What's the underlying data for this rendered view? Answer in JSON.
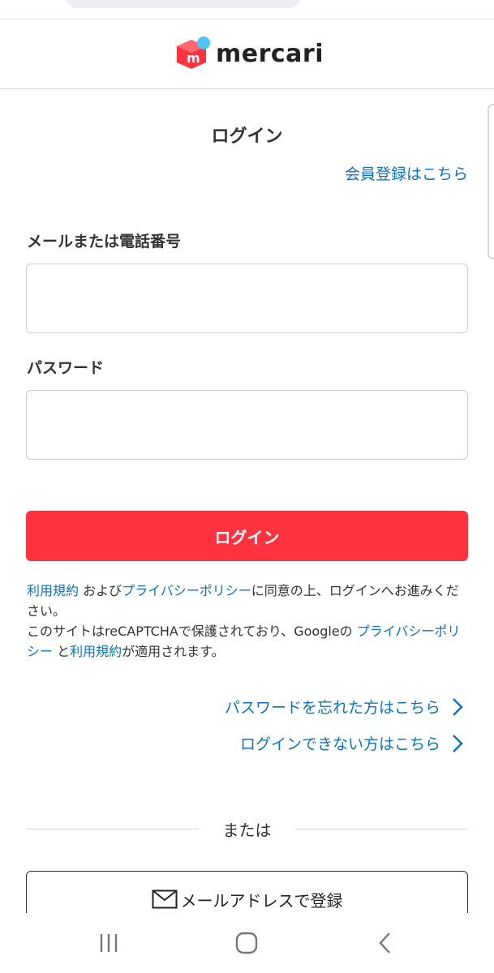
{
  "brand": {
    "name": "mercari",
    "accent": "#ff333f",
    "link_color": "#0b74c2",
    "logo_dot_color": "#4fc3f7",
    "logo_letter": "m"
  },
  "page": {
    "title": "ログイン",
    "signup_link": "会員登録はこちら"
  },
  "form": {
    "email_label": "メールまたは電話番号",
    "email_value": "",
    "password_label": "パスワード",
    "password_value": "",
    "submit_label": "ログイン"
  },
  "notice": {
    "terms_link": "利用規約",
    "and_text": " および",
    "privacy_link": "プライバシーポリシー",
    "agree_text": "に同意の上、ログインへお進みください。",
    "recaptcha_text": "このサイトはreCAPTCHAで保護されており、Googleの ",
    "google_privacy_link": "プライバシーポリシー",
    "and2_text": " と",
    "google_terms_link": "利用規約",
    "applies_text": "が適用されます。"
  },
  "help": {
    "forgot_password": "パスワードを忘れた方はこちら",
    "cannot_login": "ログインできない方はこちら"
  },
  "divider": {
    "or_text": "または"
  },
  "register": {
    "email_label": "メールアドレスで登録",
    "icon": "mail-icon"
  },
  "system_nav": {
    "recents": "recents-icon",
    "home": "home-icon",
    "back": "back-icon"
  }
}
